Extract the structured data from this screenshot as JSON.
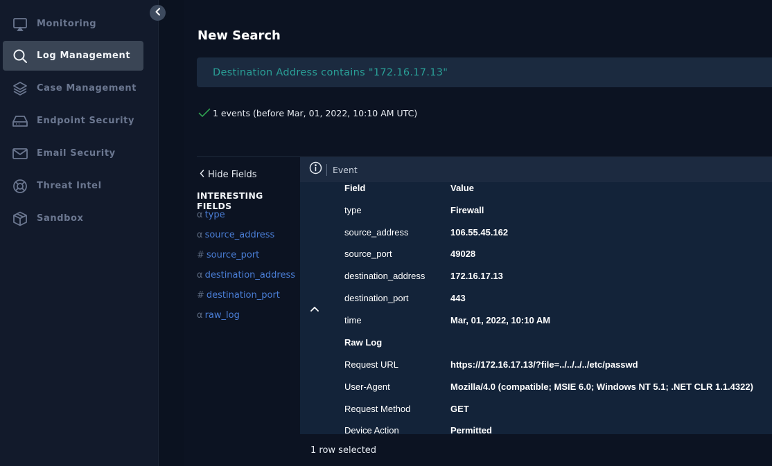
{
  "sidebar": {
    "items": [
      {
        "label": "Monitoring",
        "icon": "monitor-icon",
        "active": false
      },
      {
        "label": "Log Management",
        "icon": "search-icon",
        "active": true
      },
      {
        "label": "Case Management",
        "icon": "layers-icon",
        "active": false
      },
      {
        "label": "Endpoint Security",
        "icon": "hard-drive-icon",
        "active": false
      },
      {
        "label": "Email Security",
        "icon": "mail-icon",
        "active": false
      },
      {
        "label": "Threat Intel",
        "icon": "lifebuoy-icon",
        "active": false
      },
      {
        "label": "Sandbox",
        "icon": "cube-icon",
        "active": false
      }
    ]
  },
  "page": {
    "title": "New Search",
    "query": "Destination Address contains \"172.16.17.13\"",
    "result_status": "1 events (before Mar, 01, 2022, 10:10 AM UTC)"
  },
  "fields_panel": {
    "hide_label": "Hide Fields",
    "title": "INTERESTING FIELDS",
    "fields": [
      {
        "type": "α",
        "name": "type"
      },
      {
        "type": "α",
        "name": "source_address"
      },
      {
        "type": "#",
        "name": "source_port"
      },
      {
        "type": "α",
        "name": "destination_address"
      },
      {
        "type": "#",
        "name": "destination_port"
      },
      {
        "type": "α",
        "name": "raw_log"
      }
    ]
  },
  "event_panel": {
    "header_label": "Event",
    "column_field": "Field",
    "column_value": "Value",
    "rows": [
      {
        "key": "type",
        "value": "Firewall"
      },
      {
        "key": "source_address",
        "value": "106.55.45.162"
      },
      {
        "key": "source_port",
        "value": "49028"
      },
      {
        "key": "destination_address",
        "value": "172.16.17.13"
      },
      {
        "key": "destination_port",
        "value": "443"
      },
      {
        "key": "time",
        "value": "Mar, 01, 2022, 10:10 AM"
      },
      {
        "key": "Raw Log",
        "value": ""
      },
      {
        "key": "Request URL",
        "value": "https://172.16.17.13/?file=../../../../etc/passwd"
      },
      {
        "key": "User-Agent",
        "value": "Mozilla/4.0 (compatible; MSIE 6.0; Windows NT 5.1; .NET CLR 1.1.4322)"
      },
      {
        "key": "Request Method",
        "value": "GET"
      },
      {
        "key": "Device Action",
        "value": "Permitted"
      }
    ],
    "footer": "1 row selected"
  },
  "colors": {
    "sidebar_bg": "#121a2b",
    "active_item_bg": "#3a4555",
    "query_text": "#2aa198",
    "field_link": "#4a7ed6",
    "success_check": "#2e9e4f",
    "event_bg": "#132339"
  }
}
